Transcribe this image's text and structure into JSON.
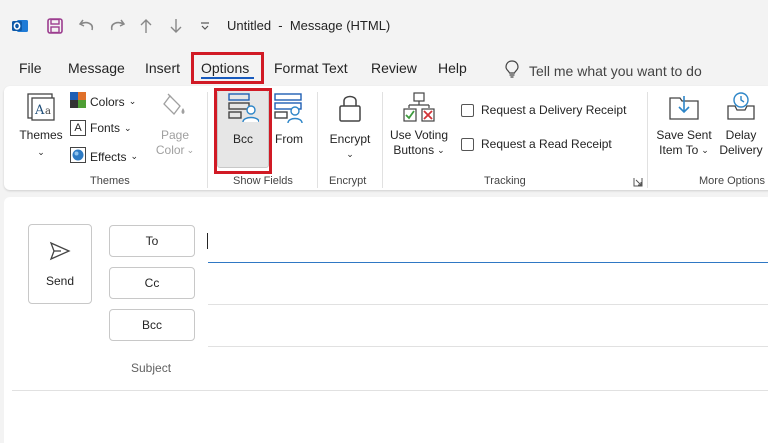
{
  "titlebar": {
    "title": "Untitled  -  Message (HTML)",
    "icons": [
      "outlook-app-icon",
      "save-icon",
      "undo-icon",
      "redo-icon",
      "up-arrow-icon",
      "down-arrow-icon",
      "customize-qat-icon"
    ]
  },
  "menu": {
    "tabs": [
      "File",
      "Message",
      "Insert",
      "Options",
      "Format Text",
      "Review",
      "Help"
    ],
    "active": "Options",
    "tell_me": "Tell me what you want to do"
  },
  "ribbon": {
    "themes_group": {
      "label": "Themes",
      "themes_label": "Themes",
      "colors_label": "Colors",
      "fonts_label": "Fonts",
      "effects_label": "Effects",
      "page_label": "Page",
      "page_color_label": "Color"
    },
    "show_fields_group": {
      "label": "Show Fields",
      "bcc_label": "Bcc",
      "from_label": "From"
    },
    "encrypt_group": {
      "label": "Encrypt",
      "encrypt_label": "Encrypt"
    },
    "tracking_group": {
      "label": "Tracking",
      "voting_line1": "Use Voting",
      "voting_line2": "Buttons",
      "delivery_receipt": "Request a Delivery Receipt",
      "read_receipt": "Request a Read Receipt"
    },
    "more_options_group": {
      "label": "More Options",
      "save_sent_line1": "Save Sent",
      "save_sent_line2": "Item To",
      "delay_line1": "Delay",
      "delay_line2": "Delivery"
    }
  },
  "compose": {
    "send_label": "Send",
    "to_label": "To",
    "cc_label": "Cc",
    "bcc_label": "Bcc",
    "subject_label": "Subject"
  },
  "colors": {
    "accent": "#185abd",
    "highlight": "#d11a25",
    "focus_line": "#2f78c4"
  }
}
